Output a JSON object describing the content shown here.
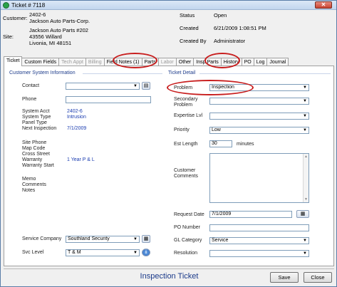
{
  "window": {
    "title": "Ticket # 7118",
    "close_glyph": "✕"
  },
  "header": {
    "customer_label": "Customer:",
    "customer_line1": "2402-6",
    "customer_line2": "Jackson Auto Parts-Corp.",
    "site_label": "Site:",
    "site_line1": "Jackson Auto Parts #202",
    "site_line2": "43556 Willard",
    "site_line3": "Livonia, MI  48151",
    "status_label": "Status",
    "status_value": "Open",
    "created_label": "Created",
    "created_value": "6/21/2009 1:08:51 PM",
    "created_by_label": "Created By",
    "created_by_value": "Administrator"
  },
  "tabs": [
    {
      "label": "Ticket",
      "active": true,
      "disabled": false
    },
    {
      "label": "Custom Fields",
      "active": false,
      "disabled": false
    },
    {
      "label": "Tech Appt",
      "active": false,
      "disabled": true
    },
    {
      "label": "Billing",
      "active": false,
      "disabled": true
    },
    {
      "label": "Field Notes (1)",
      "active": false,
      "disabled": false
    },
    {
      "label": "Parts",
      "active": false,
      "disabled": false
    },
    {
      "label": "Labor",
      "active": false,
      "disabled": true
    },
    {
      "label": "Other",
      "active": false,
      "disabled": false
    },
    {
      "label": "Insp Parts",
      "active": false,
      "disabled": false
    },
    {
      "label": "History",
      "active": false,
      "disabled": false
    },
    {
      "label": "PO",
      "active": false,
      "disabled": false
    },
    {
      "label": "Log",
      "active": false,
      "disabled": false
    },
    {
      "label": "Journal",
      "active": false,
      "disabled": false
    }
  ],
  "left": {
    "group_title": "Customer System Information",
    "contact_label": "Contact",
    "contact_value": "",
    "phone_label": "Phone",
    "phone_value": "",
    "system_acct_label": "System Acct",
    "system_acct_value": "2402-6",
    "system_type_label": "System Type",
    "system_type_value": "Intrusion",
    "panel_type_label": "Panel Type",
    "next_inspection_label": "Next Inspection",
    "next_inspection_value": "7/1/2009",
    "site_phone_label": "Site Phone",
    "map_code_label": "Map Code",
    "cross_street_label": "Cross Street",
    "warranty_label": "Warranty",
    "warranty_value": "1 Year P & L",
    "warranty_start_label": "Warranty Start",
    "memo_label": "Memo",
    "comments_label": "Comments",
    "notes_label": "Notes",
    "service_company_label": "Service Company",
    "service_company_value": "Southland Security",
    "svc_level_label": "Svc Level",
    "svc_level_value": "T & M"
  },
  "right": {
    "group_title": "Ticket Detail",
    "problem_label": "Problem",
    "problem_value": "Inspection",
    "secondary_problem_label": "Secondary Problem",
    "secondary_problem_value": "",
    "expertise_label": "Expertise Lvl",
    "expertise_value": "",
    "priority_label": "Priority",
    "priority_value": "Low",
    "est_length_label": "Est Length",
    "est_length_value": "30",
    "est_length_unit": "minutes",
    "customer_comments_label": "Customer Comments",
    "customer_comments_value": "",
    "request_date_label": "Request Date",
    "request_date_value": "7/1/2009",
    "po_number_label": "PO Number",
    "po_number_value": "",
    "gl_category_label": "GL Category",
    "gl_category_value": "Service",
    "resolution_label": "Resolution",
    "resolution_value": ""
  },
  "footer": {
    "title": "Inspection Ticket",
    "save_label": "Save",
    "close_label": "Close"
  },
  "icons": {
    "dropdown_arrow": "▼",
    "scroll_up": "▲",
    "scroll_down": "▼",
    "contact_glyph": "▤",
    "company_glyph": "▦",
    "info_glyph": "i",
    "calendar_glyph": "▦"
  },
  "colors": {
    "accent": "#1b3a8a",
    "link_value": "#1a3cb0",
    "annotation": "#c81e1e",
    "app_icon": "#2aa24a"
  }
}
